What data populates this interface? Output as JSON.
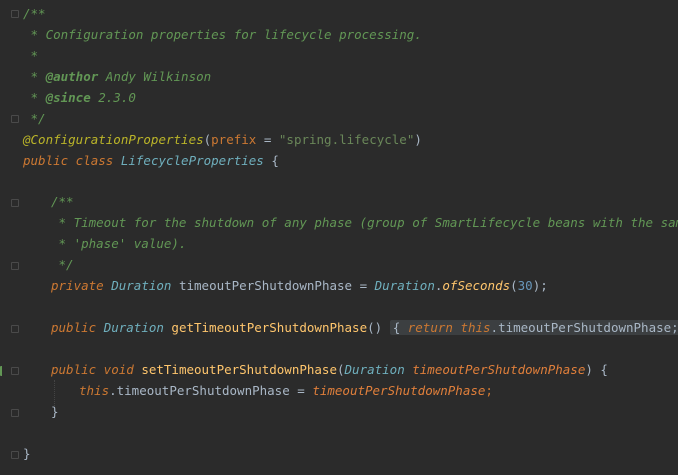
{
  "editor": {
    "theme": "darcula",
    "colors": {
      "background": "#2b2b2b",
      "keyword": "#cc7832",
      "doc": "#629755",
      "string": "#6a8759",
      "number": "#6897bb",
      "method": "#ffc66d"
    },
    "lines": {
      "l1": "/**",
      "l2": " * Configuration properties for lifecycle processing.",
      "l3": " *",
      "l4_star": " * ",
      "l4_tag": "@author",
      "l4_val": " Andy Wilkinson",
      "l5_star": " * ",
      "l5_tag": "@since",
      "l5_val": " 2.3.0",
      "l6": " */",
      "l7_ann": "@ConfigurationProperties",
      "l7_open": "(",
      "l7_attr": "prefix",
      "l7_eq": " = ",
      "l7_str": "\"spring.lifecycle\"",
      "l7_close": ")",
      "l8_kw1": "public",
      "l8_kw2": " class ",
      "l8_cls": "LifecycleProperties",
      "l8_brace": " {",
      "l10": "/**",
      "l11": " * Timeout for the shutdown of any phase (group of SmartLifecycle beans with the same",
      "l12": " * 'phase' value).",
      "l13": " */",
      "l14_kw": "private ",
      "l14_type": "Duration",
      "l14_name": " timeoutPerShutdownPhase",
      "l14_eq": " = ",
      "l14_cls": "Duration",
      "l14_dot": ".",
      "l14_meth": "ofSeconds",
      "l14_open": "(",
      "l14_num": "30",
      "l14_close": ");",
      "l16_kw": "public ",
      "l16_type": "Duration",
      "l16_meth": " getTimeoutPerShutdownPhase",
      "l16_parens": "() ",
      "l16_fold_open": "{",
      "l16_ret": " return ",
      "l16_this": "this",
      "l16_field": ".timeoutPerShutdownPhase; ",
      "l16_fold_close": "}",
      "l18_kw": "public void ",
      "l18_meth": "setTimeoutPerShutdownPhase",
      "l18_open": "(",
      "l18_type": "Duration",
      "l18_param": " timeoutPerShutdownPhase",
      "l18_close": ") {",
      "l19_this": "this",
      "l19_field": ".timeoutPerShutdownPhase = ",
      "l19_param": "timeoutPerShutdownPhase",
      "l19_semi": ";",
      "l20": "}",
      "l22": "}"
    }
  }
}
